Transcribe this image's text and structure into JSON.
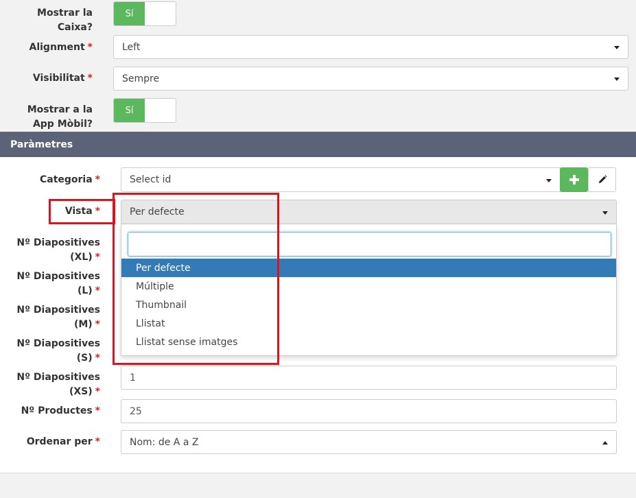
{
  "top_form": {
    "mostrar_caixa_label": "Mostrar la Caixa?",
    "mostrar_caixa_toggle": "Sí",
    "alignment_label": "Alignment",
    "alignment_value": "Left",
    "visibilitat_label": "Visibilitat",
    "visibilitat_value": "Sempre",
    "mostrar_app_label": "Mostrar a la App Mòbil?",
    "mostrar_app_toggle": "Sí"
  },
  "panel": {
    "title": "Paràmetres",
    "categoria_label": "Categoria",
    "categoria_value": "Select id",
    "vista_label": "Vista",
    "vista_value": "Per defecte",
    "diap_xl_label": "Nº Diapositives (XL)",
    "diap_l_label": "Nº Diapositives (L)",
    "diap_m_label": "Nº Diapositives (M)",
    "diap_s_label": "Nº Diapositives (S)",
    "diap_xs_label": "Nº Diapositives (XS)",
    "diap_xs_value": "1",
    "productes_label": "Nº Productes",
    "productes_value": "25",
    "ordenar_label": "Ordenar per",
    "ordenar_value": "Nom: de A a Z"
  },
  "required_marker": "*",
  "dropdown": {
    "search_value": "",
    "options": [
      "Per defecte",
      "Múltiple",
      "Thumbnail",
      "Llistat",
      "Llistat sense imatges"
    ],
    "selected_index": 0
  },
  "colors": {
    "panel_header": "#5b6379",
    "toggle_on": "#5cb85c",
    "option_selected": "#337ab7",
    "required": "#d9222a",
    "highlight": "#e2111c"
  },
  "icons": {
    "add": "plus-icon",
    "edit": "pencil-icon"
  }
}
